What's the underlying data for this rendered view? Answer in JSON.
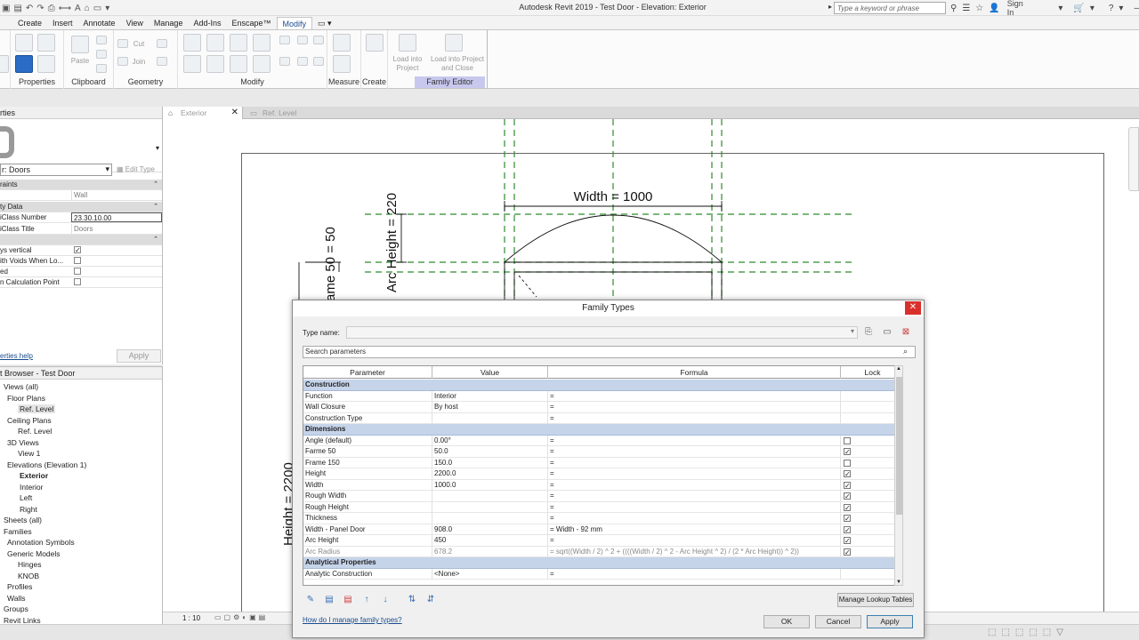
{
  "window": {
    "title": "Autodesk Revit 2019 - Test Door - Elevation: Exterior",
    "search_placeholder": "Type a keyword or phrase",
    "sign_in": "Sign In"
  },
  "ribbon": {
    "tabs": [
      "Create",
      "Insert",
      "Annotate",
      "View",
      "Manage",
      "Add-Ins",
      "Enscape™",
      "Modify"
    ],
    "active_tab": "Modify",
    "groups": {
      "properties": "Properties",
      "clipboard": "Clipboard",
      "geometry": "Geometry",
      "modify": "Modify",
      "measure": "Measure",
      "create": "Create",
      "family_editor": "Family Editor"
    },
    "tools": {
      "paste": "Paste",
      "cut": "Cut",
      "join": "Join",
      "load_into_project": "Load into Project",
      "load_into_project_close": "Load into Project and Close"
    }
  },
  "properties": {
    "header": "rties",
    "type_selector": "r: Doors",
    "edit_type": "Edit Type",
    "rows": [
      {
        "kind": "section",
        "label": "raints"
      },
      {
        "kind": "value",
        "label": "",
        "value": "Wall",
        "edit": false
      },
      {
        "kind": "section",
        "label": "ty Data"
      },
      {
        "kind": "value",
        "label": "iClass Number",
        "value": "23.30.10.00",
        "edit": true
      },
      {
        "kind": "value",
        "label": "iClass Title",
        "value": "Doors",
        "edit": false
      },
      {
        "kind": "section",
        "label": ""
      },
      {
        "kind": "check",
        "label": "ys vertical",
        "checked": true
      },
      {
        "kind": "check",
        "label": "ith Voids When Lo...",
        "checked": false
      },
      {
        "kind": "check",
        "label": "ed",
        "checked": false
      },
      {
        "kind": "check",
        "label": "n Calculation Point",
        "checked": false
      }
    ],
    "help_link": "erties help",
    "apply": "Apply"
  },
  "project_browser": {
    "header": "t Browser - Test Door",
    "nodes": [
      {
        "label": "Views (all)",
        "indent": 4,
        "bold": false,
        "selected": false
      },
      {
        "label": "Floor Plans",
        "indent": 8,
        "bold": false,
        "selected": false
      },
      {
        "label": "Ref. Level",
        "indent": 20,
        "bold": false,
        "selected": true
      },
      {
        "label": "Ceiling Plans",
        "indent": 8,
        "bold": false,
        "selected": false
      },
      {
        "label": "Ref. Level",
        "indent": 20,
        "bold": false,
        "selected": false
      },
      {
        "label": "3D Views",
        "indent": 8,
        "bold": false,
        "selected": false
      },
      {
        "label": "View 1",
        "indent": 20,
        "bold": false,
        "selected": false
      },
      {
        "label": "Elevations (Elevation 1)",
        "indent": 8,
        "bold": false,
        "selected": false
      },
      {
        "label": "Exterior",
        "indent": 22,
        "bold": true,
        "selected": false
      },
      {
        "label": "Interior",
        "indent": 22,
        "bold": false,
        "selected": false
      },
      {
        "label": "Left",
        "indent": 22,
        "bold": false,
        "selected": false
      },
      {
        "label": "Right",
        "indent": 22,
        "bold": false,
        "selected": false
      },
      {
        "label": "Sheets (all)",
        "indent": 4,
        "bold": false,
        "selected": false
      },
      {
        "label": "Families",
        "indent": 4,
        "bold": false,
        "selected": false
      },
      {
        "label": "Annotation Symbols",
        "indent": 8,
        "bold": false,
        "selected": false
      },
      {
        "label": "Generic Models",
        "indent": 8,
        "bold": false,
        "selected": false
      },
      {
        "label": "Hinges",
        "indent": 20,
        "bold": false,
        "selected": false
      },
      {
        "label": "KNOB",
        "indent": 20,
        "bold": false,
        "selected": false
      },
      {
        "label": "Profiles",
        "indent": 8,
        "bold": false,
        "selected": false
      },
      {
        "label": "Walls",
        "indent": 8,
        "bold": false,
        "selected": false
      },
      {
        "label": "Groups",
        "indent": 4,
        "bold": false,
        "selected": false
      },
      {
        "label": "Revit Links",
        "indent": 4,
        "bold": false,
        "selected": false
      }
    ]
  },
  "view_tabs": [
    {
      "label": "Exterior",
      "active": true
    },
    {
      "label": "Ref. Level",
      "active": false
    }
  ],
  "drawing": {
    "width_label": "Width = 1000",
    "arc_height_label": "Arc Height = 220",
    "frame_label": "rame 50 = 50",
    "height_label": "Height = 2200"
  },
  "status_bar": {
    "scale": "1 : 10"
  },
  "dialog": {
    "title": "Family Types",
    "type_name_label": "Type name:",
    "search_placeholder": "Search parameters",
    "columns": [
      "Parameter",
      "Value",
      "Formula",
      "Lock"
    ],
    "rows": [
      {
        "kind": "section",
        "label": "Construction"
      },
      {
        "kind": "param",
        "name": "Function",
        "value": "Interior",
        "formula": "=",
        "lock": null
      },
      {
        "kind": "param",
        "name": "Wall Closure",
        "value": "By host",
        "formula": "=",
        "lock": null
      },
      {
        "kind": "param",
        "name": "Construction Type",
        "value": "",
        "formula": "=",
        "lock": null
      },
      {
        "kind": "section",
        "label": "Dimensions"
      },
      {
        "kind": "param",
        "name": "Angle (default)",
        "value": "0.00°",
        "formula": "=",
        "lock": false
      },
      {
        "kind": "param",
        "name": "Farme 50",
        "value": "50.0",
        "formula": "=",
        "lock": true
      },
      {
        "kind": "param",
        "name": "Frame 150",
        "value": "150.0",
        "formula": "=",
        "lock": false
      },
      {
        "kind": "param",
        "name": "Height",
        "value": "2200.0",
        "formula": "=",
        "lock": true
      },
      {
        "kind": "param",
        "name": "Width",
        "value": "1000.0",
        "formula": "=",
        "lock": true
      },
      {
        "kind": "param",
        "name": "Rough Width",
        "value": "",
        "formula": "=",
        "lock": true
      },
      {
        "kind": "param",
        "name": "Rough Height",
        "value": "",
        "formula": "=",
        "lock": true
      },
      {
        "kind": "param",
        "name": "Thickness",
        "value": "",
        "formula": "=",
        "lock": true
      },
      {
        "kind": "param",
        "name": "Width - Panel Door",
        "value": "908.0",
        "formula": "= Width - 92 mm",
        "lock": true
      },
      {
        "kind": "param",
        "name": "Arc Height",
        "value": "450",
        "formula": "=",
        "lock": true
      },
      {
        "kind": "param",
        "name": "Arc Radius",
        "value": "678.2",
        "formula": "= sqrt((Width / 2) ^ 2 + ((((Width / 2) ^ 2 - Arc Height ^ 2) / (2 * Arc Height)) ^ 2))",
        "lock": true,
        "grey": true
      },
      {
        "kind": "section",
        "label": "Analytical Properties"
      },
      {
        "kind": "param",
        "name": "Analytic Construction",
        "value": "<None>",
        "formula": "=",
        "lock": null
      }
    ],
    "manage_lookup": "Manage Lookup Tables",
    "help_link": "How do I manage family types?",
    "ok": "OK",
    "cancel": "Cancel",
    "apply": "Apply"
  }
}
